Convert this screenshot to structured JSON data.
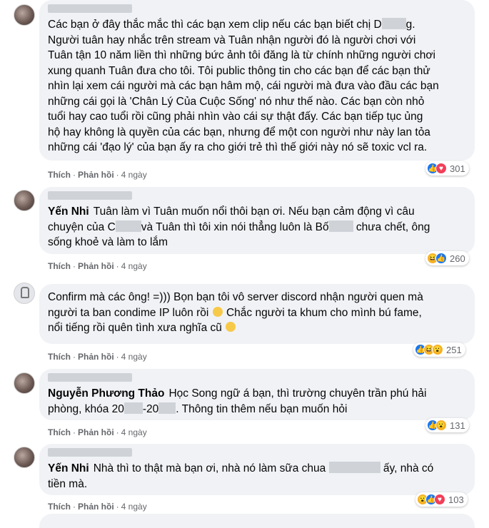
{
  "comments": [
    {
      "author": "",
      "lines": [
        "Các bạn ở đây thắc mắc thì các bạn xem clip nếu các bạn biết chị D",
        "Người tuân hay nhắc trên stream và Tuân nhận người đó là người chơi với",
        "Tuân tận 10 năm liền thì những bức ảnh tôi đăng là từ chính những người chơi",
        "xung quanh Tuân đưa cho tôi. Tôi public thông tin cho các bạn để các bạn thử",
        "nhìn lại xem cái người mà các bạn hâm mộ, cái người mà đưa vào đầu các bạn",
        "những cái gọi là 'Chân Lý Của Cuộc Sống' nó như thế nào. Các bạn còn nhỏ",
        "tuổi hay cao tuổi rồi cũng phải nhìn vào cái sự thật đấy. Các bạn tiếp tục ủng",
        "hộ hay không là quyền của các bạn, nhưng để một con người như này lan tỏa",
        "những cái 'đạo lý' của bạn ấy ra cho giới trẻ thì thế giới này nó sẽ toxic vcl ra."
      ],
      "like_label": "Thích",
      "reply_label": "Phản hồi",
      "time": "4 ngày",
      "reaction_count": "301",
      "reactions": [
        "like",
        "love"
      ]
    },
    {
      "author": "Yến Nhi",
      "lines": [
        "Tuân làm vì Tuân muốn nổi thôi bạn ơi. Nếu bạn cảm động vì câu",
        "chuyện của C",
        "và Tuân thì tôi xin nói thẳng luôn là Bố",
        "chưa chết, ông",
        "sống khoẻ và làm to lắm"
      ],
      "like_label": "Thích",
      "reply_label": "Phản hồi",
      "time": "4 ngày",
      "reaction_count": "260",
      "reactions": [
        "haha",
        "like"
      ]
    },
    {
      "author": "",
      "lines": [
        "Confirm mà các ông! =))) Bọn bạn tôi vô server discord nhận người quen mà",
        "người ta ban condime IP luôn rồi",
        "Chắc người ta khum cho mình bú fame,",
        "nổi tiếng rồi quên tình xưa nghĩa cũ"
      ],
      "like_label": "Thích",
      "reply_label": "Phản hồi",
      "time": "4 ngày",
      "reaction_count": "251",
      "reactions": [
        "like",
        "haha",
        "wow"
      ]
    },
    {
      "author": "Nguyễn Phương Thảo",
      "lines": [
        "Học Song ngữ á bạn, thì trường chuyên trần phú hải",
        "phòng, khóa 20",
        "-20",
        ". Thông tin thêm nếu bạn muốn hỏi"
      ],
      "like_label": "Thích",
      "reply_label": "Phản hồi",
      "time": "4 ngày",
      "reaction_count": "131",
      "reactions": [
        "like",
        "wow"
      ]
    },
    {
      "author": "Yến Nhi",
      "lines": [
        "Nhà thì to thật mà bạn ơi, nhà nó làm sữa chua",
        "ấy, nhà có",
        "tiền mà."
      ],
      "like_label": "Thích",
      "reply_label": "Phản hồi",
      "time": "4 ngày",
      "reaction_count": "103",
      "reactions": [
        "wow",
        "like",
        "love"
      ]
    }
  ],
  "colors": {
    "bubble": "#f0f2f5",
    "meta": "#65676b",
    "like": "#1877f2",
    "love": "#f33e58",
    "haha": "#f7b125"
  },
  "reaction_symbols": {
    "like": "👍",
    "love": "♥",
    "haha": "😆",
    "wow": "😮"
  }
}
